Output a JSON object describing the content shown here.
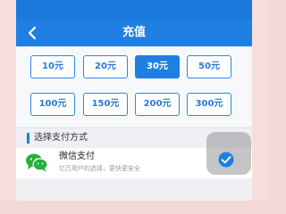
{
  "header": {
    "title": "充值",
    "back_icon": "chevron-left-icon"
  },
  "amounts": [
    {
      "label": "10元",
      "selected": false
    },
    {
      "label": "20元",
      "selected": false
    },
    {
      "label": "30元",
      "selected": true
    },
    {
      "label": "50元",
      "selected": false
    },
    {
      "label": "100元",
      "selected": false
    },
    {
      "label": "150元",
      "selected": false
    },
    {
      "label": "200元",
      "selected": false
    },
    {
      "label": "300元",
      "selected": false
    }
  ],
  "payment": {
    "section_label": "选择支付方式",
    "method_name": "微信支付",
    "method_desc": "亿万用户的选择，更快更安全",
    "method_icon": "wechat-icon",
    "selected_icon": "check-circle-icon"
  },
  "colors": {
    "accent": "#1f7fe3",
    "background": "#eef0f3"
  }
}
